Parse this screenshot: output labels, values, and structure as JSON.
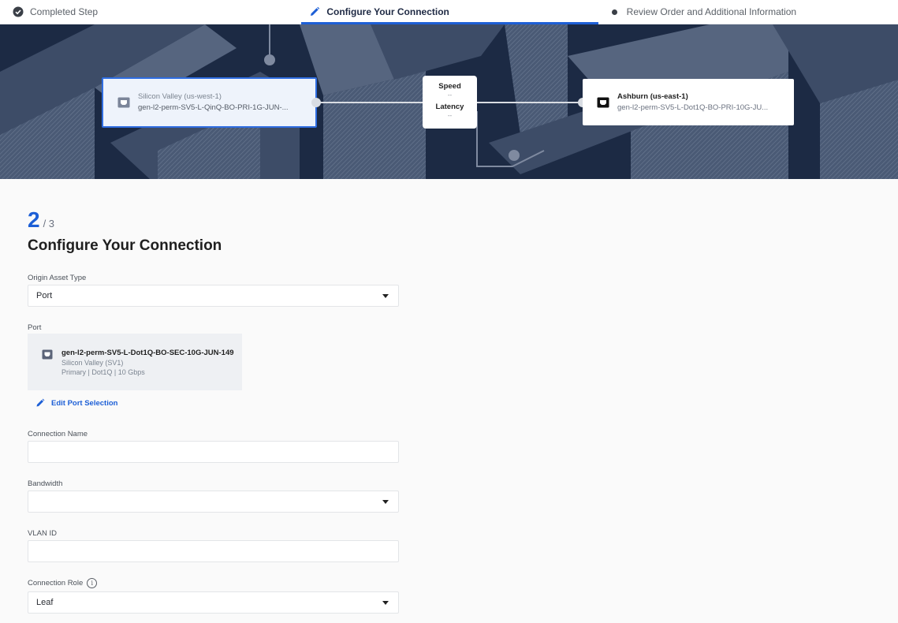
{
  "stepper": {
    "steps": [
      {
        "label": "Completed Step",
        "state": "completed",
        "icon": "check-circle-icon"
      },
      {
        "label": "Configure Your Connection",
        "state": "active",
        "icon": "pencil-icon"
      },
      {
        "label": "Review Order and Additional Information",
        "state": "pending",
        "icon": "dot-icon"
      }
    ]
  },
  "banner": {
    "origin": {
      "location": "Silicon Valley (us-west-1)",
      "asset": "gen-l2-perm-SV5-L-QinQ-BO-PRI-1G-JUN-..."
    },
    "destination": {
      "location": "Ashburn (us-east-1)",
      "asset": "gen-l2-perm-SV5-L-Dot1Q-BO-PRI-10G-JU..."
    },
    "metrics": {
      "speed_label": "Speed",
      "speed_value": "--",
      "latency_label": "Latency",
      "latency_value": "--"
    }
  },
  "form": {
    "step_current": "2",
    "step_total": "/ 3",
    "title": "Configure Your Connection",
    "origin_asset_type": {
      "label": "Origin Asset Type",
      "value": "Port"
    },
    "port": {
      "label": "Port",
      "name": "gen-l2-perm-SV5-L-Dot1Q-BO-SEC-10G-JUN-149",
      "location": "Silicon Valley (SV1)",
      "details": "Primary | Dot1Q | 10 Gbps",
      "edit_label": "Edit Port Selection"
    },
    "connection_name": {
      "label": "Connection Name",
      "value": ""
    },
    "bandwidth": {
      "label": "Bandwidth",
      "value": ""
    },
    "vlan_id": {
      "label": "VLAN ID",
      "value": ""
    },
    "connection_role": {
      "label": "Connection Role",
      "value": "Leaf"
    }
  },
  "colors": {
    "accent": "#1d5fd6",
    "banner_bg": "#1c2a44"
  }
}
